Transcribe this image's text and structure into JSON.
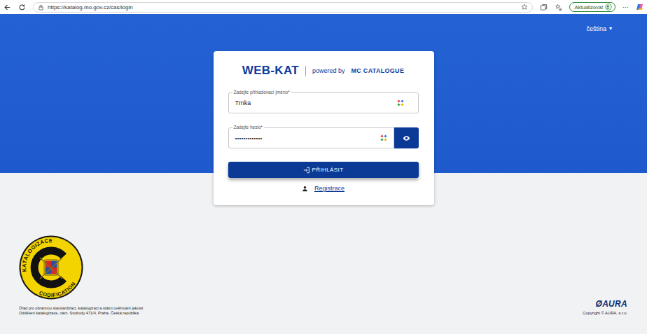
{
  "browser": {
    "url": "https://katalog.mo.gov.cz/cas/login",
    "update_button": "Aktualizovat",
    "more": "···"
  },
  "language": {
    "label": "čeština",
    "caret": "▾"
  },
  "login": {
    "title": "WEB-KAT",
    "powered_by": "powered by",
    "brand": "MC CATALOGUE",
    "fields": [
      {
        "label": "Zadejte přihlašovací jméno*",
        "value": "Trnka",
        "kind": "text"
      },
      {
        "label": "Zadejte heslo*",
        "value": "•••••••••••••",
        "kind": "password"
      }
    ],
    "submit": "PŘIHLÁSIT",
    "register": "Registrace"
  },
  "footer": {
    "emblem": {
      "top": "KATALOGIZACE",
      "bottom": "CODIFICATION"
    },
    "org_lines": [
      "Úřad pro obrannou standardizaci, katalogizaci a státní ověřování jakosti",
      "Oddělení katalogizace, nám. Svobody 471/4, Praha, Česká republika"
    ],
    "vendor": {
      "logo": "ØAURA",
      "copyright": "Copyright © AURA, s.r.o."
    }
  }
}
